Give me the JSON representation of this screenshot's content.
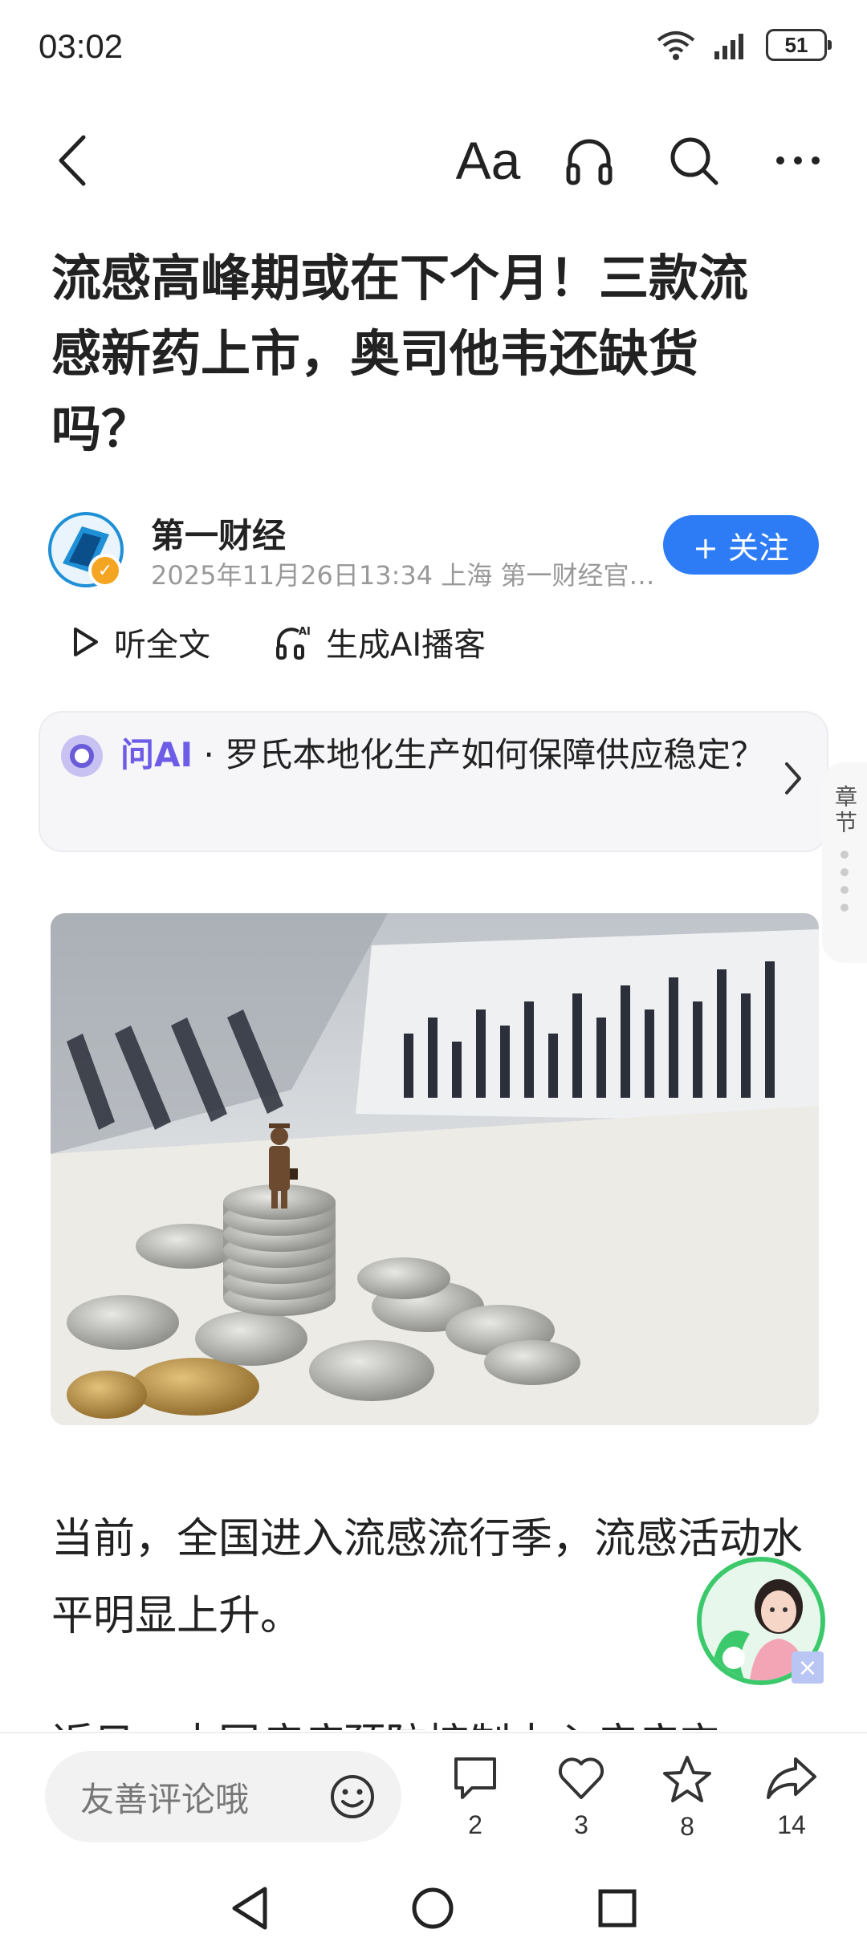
{
  "status_bar": {
    "time": "03:02",
    "battery": "51"
  },
  "toolbar": {
    "font_label": "Aa"
  },
  "article": {
    "title": "流感高峰期或在下个月！三款流感新药上市，奥司他韦还缺货吗？",
    "author": "第一财经",
    "meta": "2025年11月26日13:34 上海 第一财经官…",
    "follow_label": "+ 关注",
    "listen_full": "听全文",
    "ai_podcast": "生成AI播客",
    "paragraph1": "当前，全国进入流感流行季，流感活动水平明显上升。",
    "paragraph2_partial": "近日，中国疾病预防控制中心疾病应"
  },
  "ask_ai": {
    "brand": "问AI",
    "separator": " · ",
    "question": "罗氏本地化生产如何保障供应稳定？"
  },
  "chapter_tab": {
    "label": "章节"
  },
  "bottom_bar": {
    "comment_placeholder": "友善评论哦",
    "comments": "2",
    "likes": "3",
    "favorites": "8",
    "shares": "14"
  },
  "colors": {
    "accent": "#2d7cf6",
    "ai_purple": "#6c5ce7",
    "assistant_green": "#3cc96c"
  }
}
